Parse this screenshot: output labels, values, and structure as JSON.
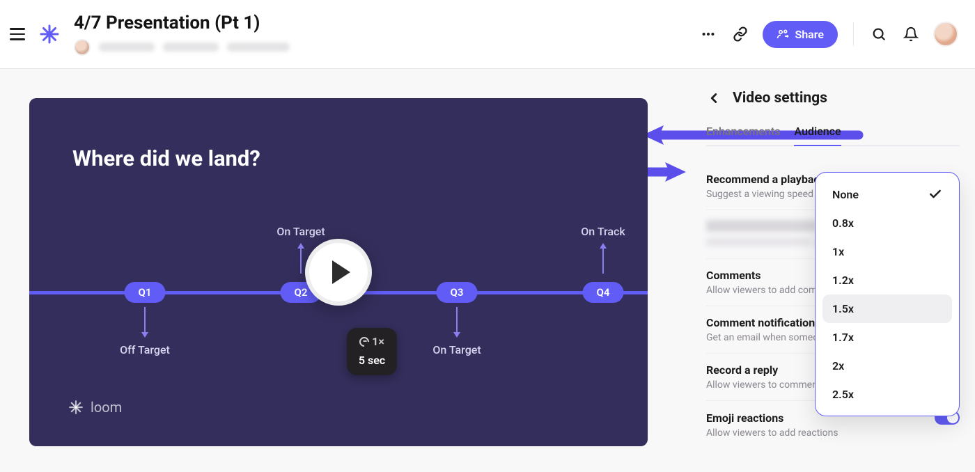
{
  "header": {
    "title": "4/7 Presentation (Pt 1)",
    "share_label": "Share"
  },
  "video": {
    "slide_title": "Where did we land?",
    "quarters": [
      "Q1",
      "Q2",
      "Q3",
      "Q4"
    ],
    "labels": {
      "on_target": "On Target",
      "on_track": "On Track",
      "off_target": "Off Target"
    },
    "playback_badge": {
      "speed": "1×",
      "duration": "5 sec"
    },
    "brand": "loom"
  },
  "sidebar": {
    "panel_title": "Video settings",
    "tabs": {
      "enhancements": "Enhancements",
      "audience": "Audience"
    },
    "settings": {
      "playback_speed": {
        "title": "Recommend a playback speed",
        "desc": "Suggest a viewing speed fo",
        "current": "None"
      },
      "comments": {
        "title": "Comments",
        "desc": "Allow viewers to add comm"
      },
      "comment_notifications": {
        "title": "Comment notification",
        "desc": "Get an email when someon"
      },
      "record_reply": {
        "title": "Record a reply",
        "desc": "Allow viewers to comment"
      },
      "emoji_reactions": {
        "title": "Emoji reactions",
        "desc": "Allow viewers to add reactions"
      }
    },
    "dropdown": {
      "options": [
        "None",
        "0.8x",
        "1x",
        "1.2x",
        "1.5x",
        "1.7x",
        "2x",
        "2.5x"
      ],
      "selected": "None",
      "hovered": "1.5x"
    }
  },
  "colors": {
    "accent": "#615cf5",
    "video_bg": "#332e5b"
  }
}
